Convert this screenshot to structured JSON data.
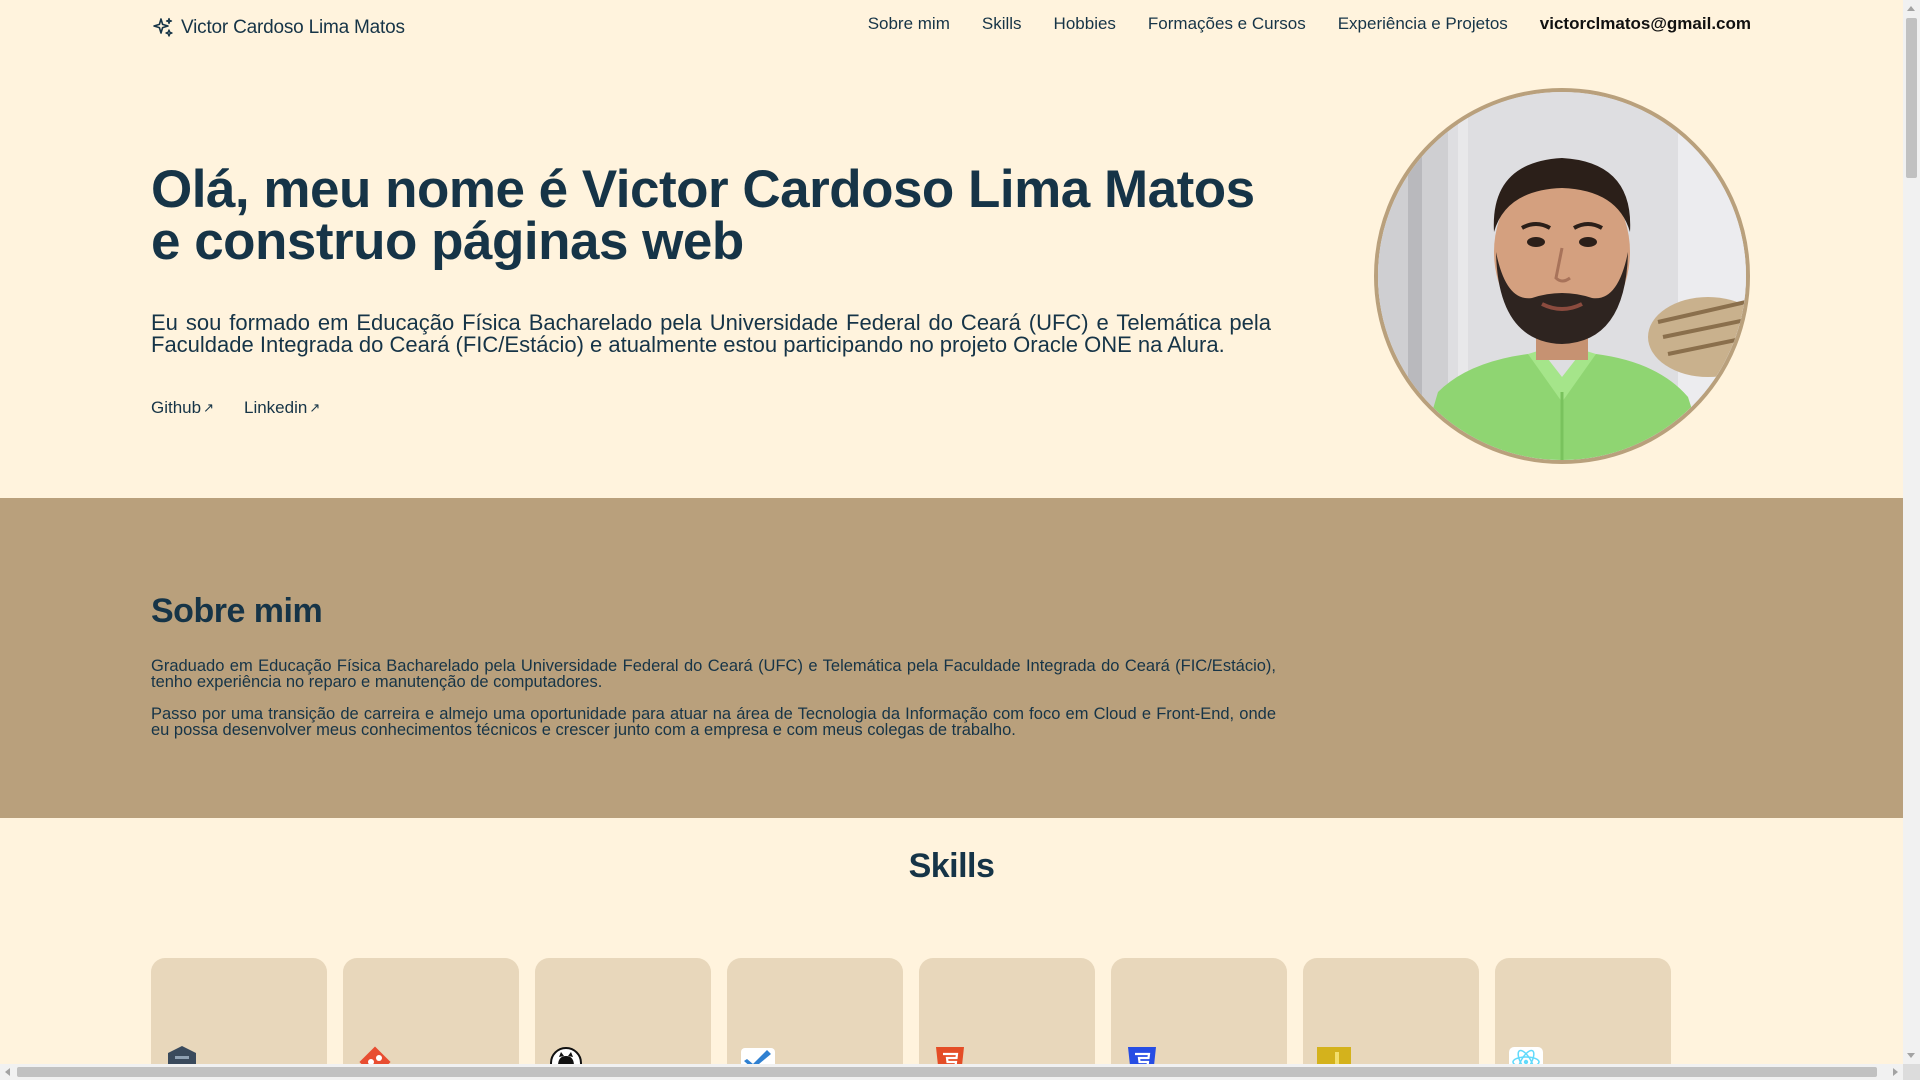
{
  "header": {
    "brand_name": "Victor Cardoso Lima Matos",
    "brand_icon": "sparkles-icon",
    "nav": {
      "about": "Sobre mim",
      "skills": "Skills",
      "hobbies": "Hobbies",
      "courses": "Formações e Cursos",
      "experience": "Experiência e Projetos",
      "email": "victorclmatos@gmail.com"
    }
  },
  "hero": {
    "title_line1": "Olá, meu nome é Victor Cardoso Lima Matos",
    "title_line2": "e construo páginas web",
    "text": "Eu sou formado em Educação Física Bacharelado pela Universidade Federal do Ceará (UFC) e Telemática pela Faculdade Integrada do Ceará (FIC/Estácio) e atualmente estou participando no projeto Oracle ONE na Alura.",
    "github_label": "Github",
    "linkedin_label": "Linkedin",
    "link_arrow": "↗"
  },
  "about": {
    "heading": "Sobre mim",
    "paragraph1": "Graduado em Educação Física Bacharelado pela Universidade Federal do Ceará (UFC) e Telemática pela Faculdade Integrada do Ceará (FIC/Estácio), tenho experiência no reparo e manutenção de computadores.",
    "paragraph2": "Passo por uma transição de carreira e almejo uma oportunidade para atuar na área de Tecnologia da Informação com foco em Cloud e Front-End, onde eu possa desenvolver meus conhecimentos técnicos e crescer junto com a empresa e com meus colegas de trabalho."
  },
  "skills": {
    "heading": "Skills",
    "cards": [
      {
        "icon": "oracle-cloud-icon",
        "color": "#3a4a5c"
      },
      {
        "icon": "git-icon",
        "color": "#e84d31"
      },
      {
        "icon": "github-icon",
        "color": "#111111"
      },
      {
        "icon": "vscode-icon",
        "color": "#2f80d1"
      },
      {
        "icon": "html5-icon",
        "color": "#e44d26"
      },
      {
        "icon": "css3-icon",
        "color": "#264de4"
      },
      {
        "icon": "javascript-icon",
        "color": "#d4b21c"
      },
      {
        "icon": "react-icon",
        "color": "#61dafb"
      }
    ]
  },
  "colors": {
    "background": "#fff3dd",
    "accent": "#b9a07c",
    "text": "#163447",
    "card": "#e8d7bb"
  }
}
